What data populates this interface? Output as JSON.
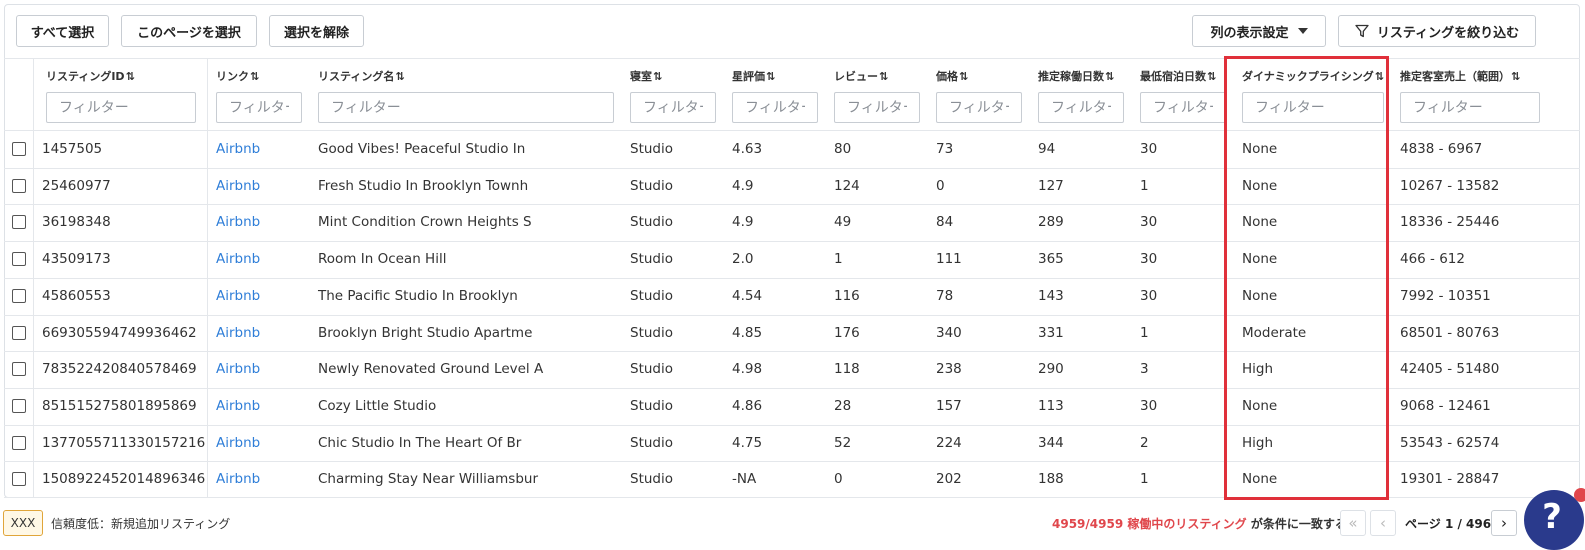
{
  "toolbar": {
    "select_all": "すべて選択",
    "select_page": "このページを選択",
    "deselect": "選択を解除",
    "column_settings": "列の表示設定",
    "filter_listings": "リスティングを絞り込む"
  },
  "sort_glyph": "⇅",
  "filter_placeholder": "フィルター",
  "columns": [
    "リスティングID",
    "リンク",
    "リスティング名",
    "寝室",
    "星評価",
    "レビュー",
    "価格",
    "推定稼働日数",
    "最低宿泊日数",
    "ダイナミックプライシング",
    "推定客室売上（範囲）"
  ],
  "rows": [
    [
      "1457505",
      "Airbnb",
      "Good Vibes! Peaceful Studio In",
      "Studio",
      "4.63",
      "80",
      "73",
      "94",
      "30",
      "None",
      "4838 - 6967"
    ],
    [
      "25460977",
      "Airbnb",
      "Fresh Studio In Brooklyn Townh",
      "Studio",
      "4.9",
      "124",
      "0",
      "127",
      "1",
      "None",
      "10267 - 13582"
    ],
    [
      "36198348",
      "Airbnb",
      "Mint Condition Crown Heights S",
      "Studio",
      "4.9",
      "49",
      "84",
      "289",
      "30",
      "None",
      "18336 - 25446"
    ],
    [
      "43509173",
      "Airbnb",
      "Room In Ocean Hill",
      "Studio",
      "2.0",
      "1",
      "111",
      "365",
      "30",
      "None",
      "466 - 612"
    ],
    [
      "45860553",
      "Airbnb",
      "The Pacific Studio In Brooklyn",
      "Studio",
      "4.54",
      "116",
      "78",
      "143",
      "30",
      "None",
      "7992 - 10351"
    ],
    [
      "669305594749936462",
      "Airbnb",
      "Brooklyn Bright Studio Apartme",
      "Studio",
      "4.85",
      "176",
      "340",
      "331",
      "1",
      "Moderate",
      "68501 - 80763"
    ],
    [
      "783522420840578469",
      "Airbnb",
      "Newly Renovated Ground Level A",
      "Studio",
      "4.98",
      "118",
      "238",
      "290",
      "3",
      "High",
      "42405 - 51480"
    ],
    [
      "851515275801895869",
      "Airbnb",
      "Cozy Little Studio",
      "Studio",
      "4.86",
      "28",
      "157",
      "113",
      "30",
      "None",
      "9068 - 12461"
    ],
    [
      "1377055711330157216",
      "Airbnb",
      "Chic Studio In The Heart Of Br",
      "Studio",
      "4.75",
      "52",
      "224",
      "344",
      "2",
      "High",
      "53543 - 62574"
    ],
    [
      "1508922452014896346",
      "Airbnb",
      "Charming Stay Near Williamsbur",
      "Studio",
      "-NA",
      "0",
      "202",
      "188",
      "1",
      "None",
      "19301 - 28847"
    ]
  ],
  "footer": {
    "legend_tag": "XXX",
    "legend_text": "信頼度低：新規追加リスティング",
    "count_text": "4959/4959 稼働中のリスティング",
    "match_text": "が条件に一致する",
    "page_text": "ページ 1 / 496",
    "first_glyph": "«",
    "prev_glyph": "‹",
    "next_glyph": "›"
  },
  "help": {
    "glyph": "?"
  },
  "colors": {
    "link": "#2f7ed8",
    "highlight": "#e0303a",
    "status_red": "#e0474c",
    "help_bg": "#2a3a8c"
  }
}
